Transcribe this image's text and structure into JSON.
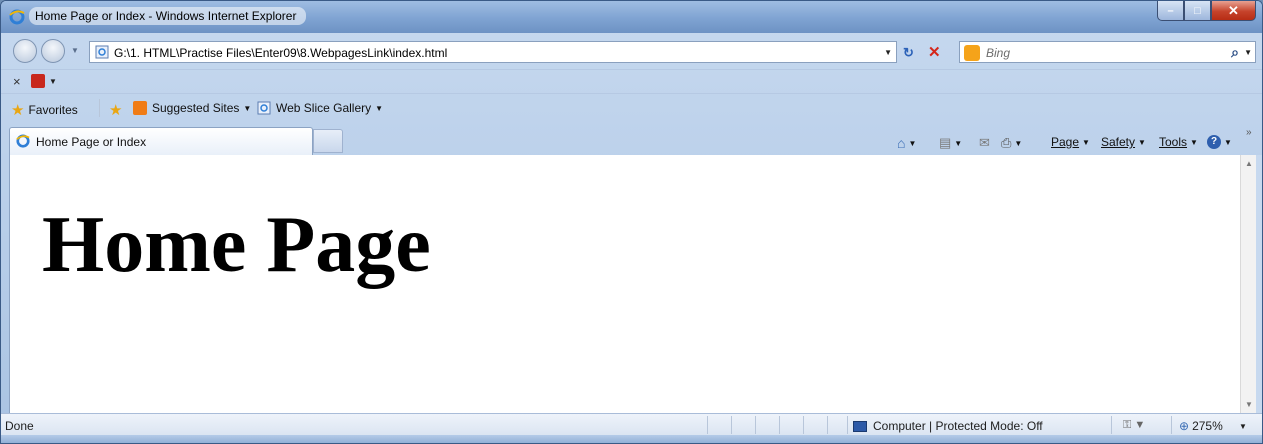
{
  "window": {
    "title": "Home Page or Index - Windows Internet Explorer",
    "min_icon": "minimize-icon",
    "max_icon": "maximize-icon",
    "close_icon": "close-icon"
  },
  "nav": {
    "url": "G:\\1. HTML\\Practise Files\\Enter09\\8.WebpagesLink\\index.html",
    "search_placeholder": "Bing"
  },
  "favorites": {
    "label": "Favorites",
    "suggested": "Suggested Sites",
    "webslice": "Web Slice Gallery"
  },
  "tab": {
    "label": "Home Page or Index"
  },
  "commandbar": {
    "page": "Page",
    "safety": "Safety",
    "tools": "Tools"
  },
  "content": {
    "heading": "Home Page"
  },
  "status": {
    "done": "Done",
    "zone": "Computer | Protected Mode: Off",
    "zoom": "275%"
  },
  "colors": {
    "accent": "#2b61b8",
    "close_red": "#c6432b"
  }
}
